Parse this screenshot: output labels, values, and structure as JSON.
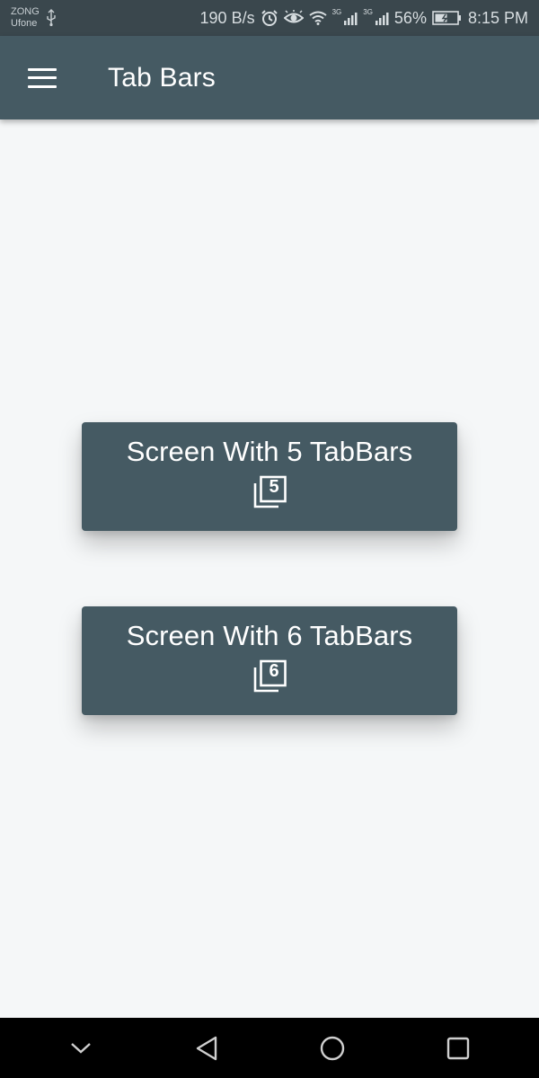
{
  "status_bar": {
    "carrier_1": "ZONG",
    "carrier_2": "Ufone",
    "speed": "190 B/s",
    "signal_1_tag": "3G",
    "signal_2_tag": "3G",
    "battery": "56%",
    "time": "8:15 PM"
  },
  "app_bar": {
    "title": "Tab Bars",
    "menu_icon": "hamburger-menu-icon"
  },
  "buttons": [
    {
      "label": "Screen With 5 TabBars",
      "icon": "filter-5-icon",
      "icon_number": "5"
    },
    {
      "label": "Screen With 6 TabBars",
      "icon": "filter-6-icon",
      "icon_number": "6"
    }
  ],
  "nav_bar": {
    "items": [
      "chevron-down-icon",
      "back-icon",
      "home-icon",
      "recents-icon"
    ]
  },
  "colors": {
    "status_bar": "#3a474d",
    "app_bar": "#455a63",
    "button": "#455a63",
    "background": "#f5f7f8",
    "nav_bar": "#000000"
  }
}
